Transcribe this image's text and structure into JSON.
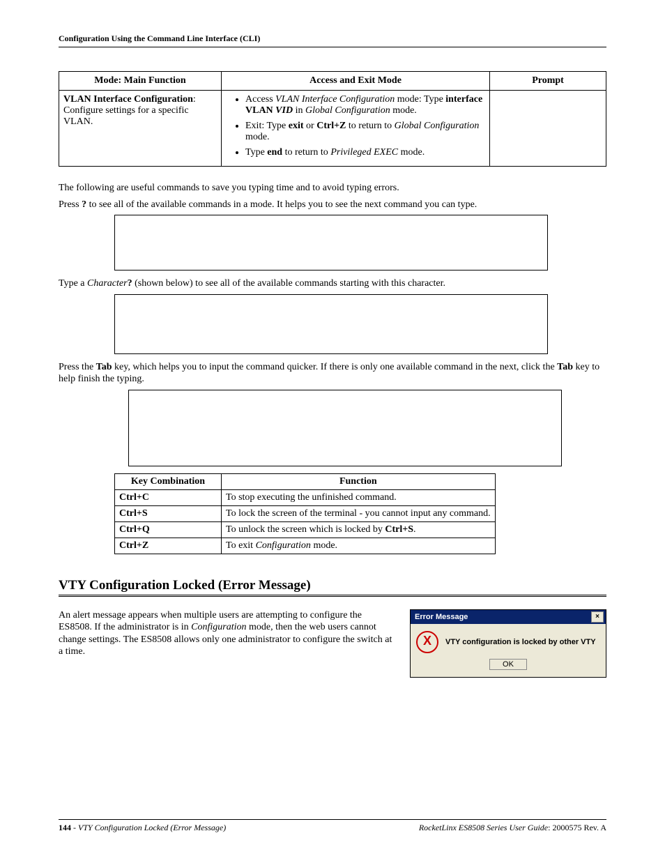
{
  "running_head": "Configuration Using the Command Line Interface (CLI)",
  "mode_table": {
    "headers": {
      "c1": "Mode: Main Function",
      "c2": "Access and Exit Mode",
      "c3": "Prompt"
    },
    "row": {
      "heading": "VLAN Interface Configuration",
      "subtext": ": Configure settings for a specific VLAN.",
      "prompt": ""
    }
  },
  "para_intro": "The following are useful commands to save you typing time and to avoid typing errors.",
  "para_q_pre": "Press ",
  "para_q_bold": "?",
  "para_q_post": " to see all of the available commands in a mode. It helps you to see the next command you can type.",
  "para_char_pre": "Type a ",
  "para_char_em": "Character",
  "para_char_bold": "?",
  "para_char_post": " (shown below) to see all of the available commands starting with this character.",
  "para_tab_1": "Press the ",
  "para_tab_b1": "Tab",
  "para_tab_2": " key, which helps you to input the command quicker. If there is only one available command in the next, click the ",
  "para_tab_b2": "Tab",
  "para_tab_3": " key to help finish the typing.",
  "key_table": {
    "headers": {
      "c1": "Key Combination",
      "c2": "Function"
    },
    "rows": [
      {
        "key": "Ctrl+C",
        "fn": "To stop executing the unfinished command."
      },
      {
        "key": "Ctrl+S",
        "fn": "To lock the screen of the terminal - you cannot input any command."
      },
      {
        "key": "Ctrl+Q",
        "fn_pre": "To unlock the screen which is locked by ",
        "fn_bold": "Ctrl+S",
        "fn_post": "."
      },
      {
        "key": "Ctrl+Z",
        "fn_pre": "To exit ",
        "fn_em": "Configuration",
        "fn_post": " mode."
      }
    ]
  },
  "section_title": "VTY Configuration Locked (Error Message)",
  "error_para_1": "An alert message appears when multiple users are attempting to configure the ES8508. If the administrator is in ",
  "error_para_em": "Configuration",
  "error_para_2": " mode, then the web users cannot change settings. The ES8508 allows only one administrator to configure the switch at a time.",
  "dialog": {
    "title": "Error Message",
    "close": "×",
    "icon": "X",
    "msg": "VTY configuration is locked by other VTY",
    "ok": "OK"
  },
  "footer": {
    "page": "144",
    "sep": " - ",
    "left_em": "VTY Configuration Locked (Error Message)",
    "right_em": "RocketLinx ES8508 Series  User Guide",
    "right_rev": ": 2000575 Rev. A"
  }
}
